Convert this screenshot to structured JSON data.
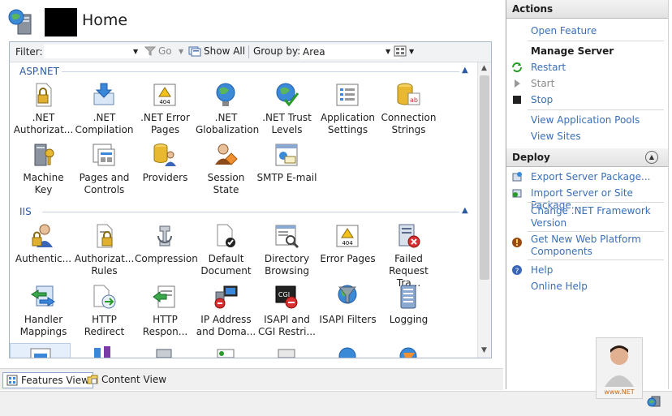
{
  "header": {
    "title": "Home"
  },
  "filter_bar": {
    "filter_label": "Filter:",
    "filter_value": "",
    "go_label": "Go",
    "show_all_label": "Show All",
    "group_by_label": "Group by:",
    "group_by_value": "Area"
  },
  "groups": [
    {
      "name": "ASP.NET",
      "items": [
        {
          "label": ".NET\nAuthorizat...",
          "icon": "dotnet-authorization-icon"
        },
        {
          "label": ".NET\nCompilation",
          "icon": "dotnet-compilation-icon"
        },
        {
          "label": ".NET Error\nPages",
          "icon": "dotnet-error-pages-icon"
        },
        {
          "label": ".NET\nGlobalization",
          "icon": "dotnet-globalization-icon"
        },
        {
          "label": ".NET Trust\nLevels",
          "icon": "dotnet-trust-levels-icon"
        },
        {
          "label": "Application\nSettings",
          "icon": "application-settings-icon"
        },
        {
          "label": "Connection\nStrings",
          "icon": "connection-strings-icon"
        },
        {
          "label": "Machine Key",
          "icon": "machine-key-icon"
        },
        {
          "label": "Pages and\nControls",
          "icon": "pages-and-controls-icon"
        },
        {
          "label": "Providers",
          "icon": "providers-icon"
        },
        {
          "label": "Session State",
          "icon": "session-state-icon"
        },
        {
          "label": "SMTP E-mail",
          "icon": "smtp-email-icon"
        }
      ]
    },
    {
      "name": "IIS",
      "items": [
        {
          "label": "Authentic...",
          "icon": "authentication-icon"
        },
        {
          "label": "Authorizat...\nRules",
          "icon": "authorization-rules-icon"
        },
        {
          "label": "Compression",
          "icon": "compression-icon"
        },
        {
          "label": "Default\nDocument",
          "icon": "default-document-icon"
        },
        {
          "label": "Directory\nBrowsing",
          "icon": "directory-browsing-icon"
        },
        {
          "label": "Error Pages",
          "icon": "error-pages-icon"
        },
        {
          "label": "Failed\nRequest Tra...",
          "icon": "failed-request-tracing-icon"
        },
        {
          "label": "Handler\nMappings",
          "icon": "handler-mappings-icon"
        },
        {
          "label": "HTTP\nRedirect",
          "icon": "http-redirect-icon"
        },
        {
          "label": "HTTP\nRespon...",
          "icon": "http-response-headers-icon"
        },
        {
          "label": "IP Address\nand Doma...",
          "icon": "ip-address-icon"
        },
        {
          "label": "ISAPI and\nCGI Restri...",
          "icon": "isapi-cgi-icon"
        },
        {
          "label": "ISAPI Filters",
          "icon": "isapi-filters-icon"
        },
        {
          "label": "Logging",
          "icon": "logging-icon"
        }
      ]
    }
  ],
  "views": {
    "features": "Features View",
    "content": "Content View"
  },
  "actions": {
    "title": "Actions",
    "open_feature": "Open Feature",
    "manage_server": "Manage Server",
    "restart": "Restart",
    "start": "Start",
    "stop": "Stop",
    "view_app_pools": "View Application Pools",
    "view_sites": "View Sites",
    "deploy_title": "Deploy",
    "export_package": "Export Server Package...",
    "import_package": "Import Server or Site Package...",
    "change_framework": "Change .NET Framework\nVersion",
    "get_web_platform": "Get New Web Platform\nComponents",
    "help": "Help",
    "online_help": "Online Help"
  },
  "watermark": "www.NET",
  "colors": {
    "link": "#3a6fb7",
    "group_header": "#2b5aa3"
  }
}
